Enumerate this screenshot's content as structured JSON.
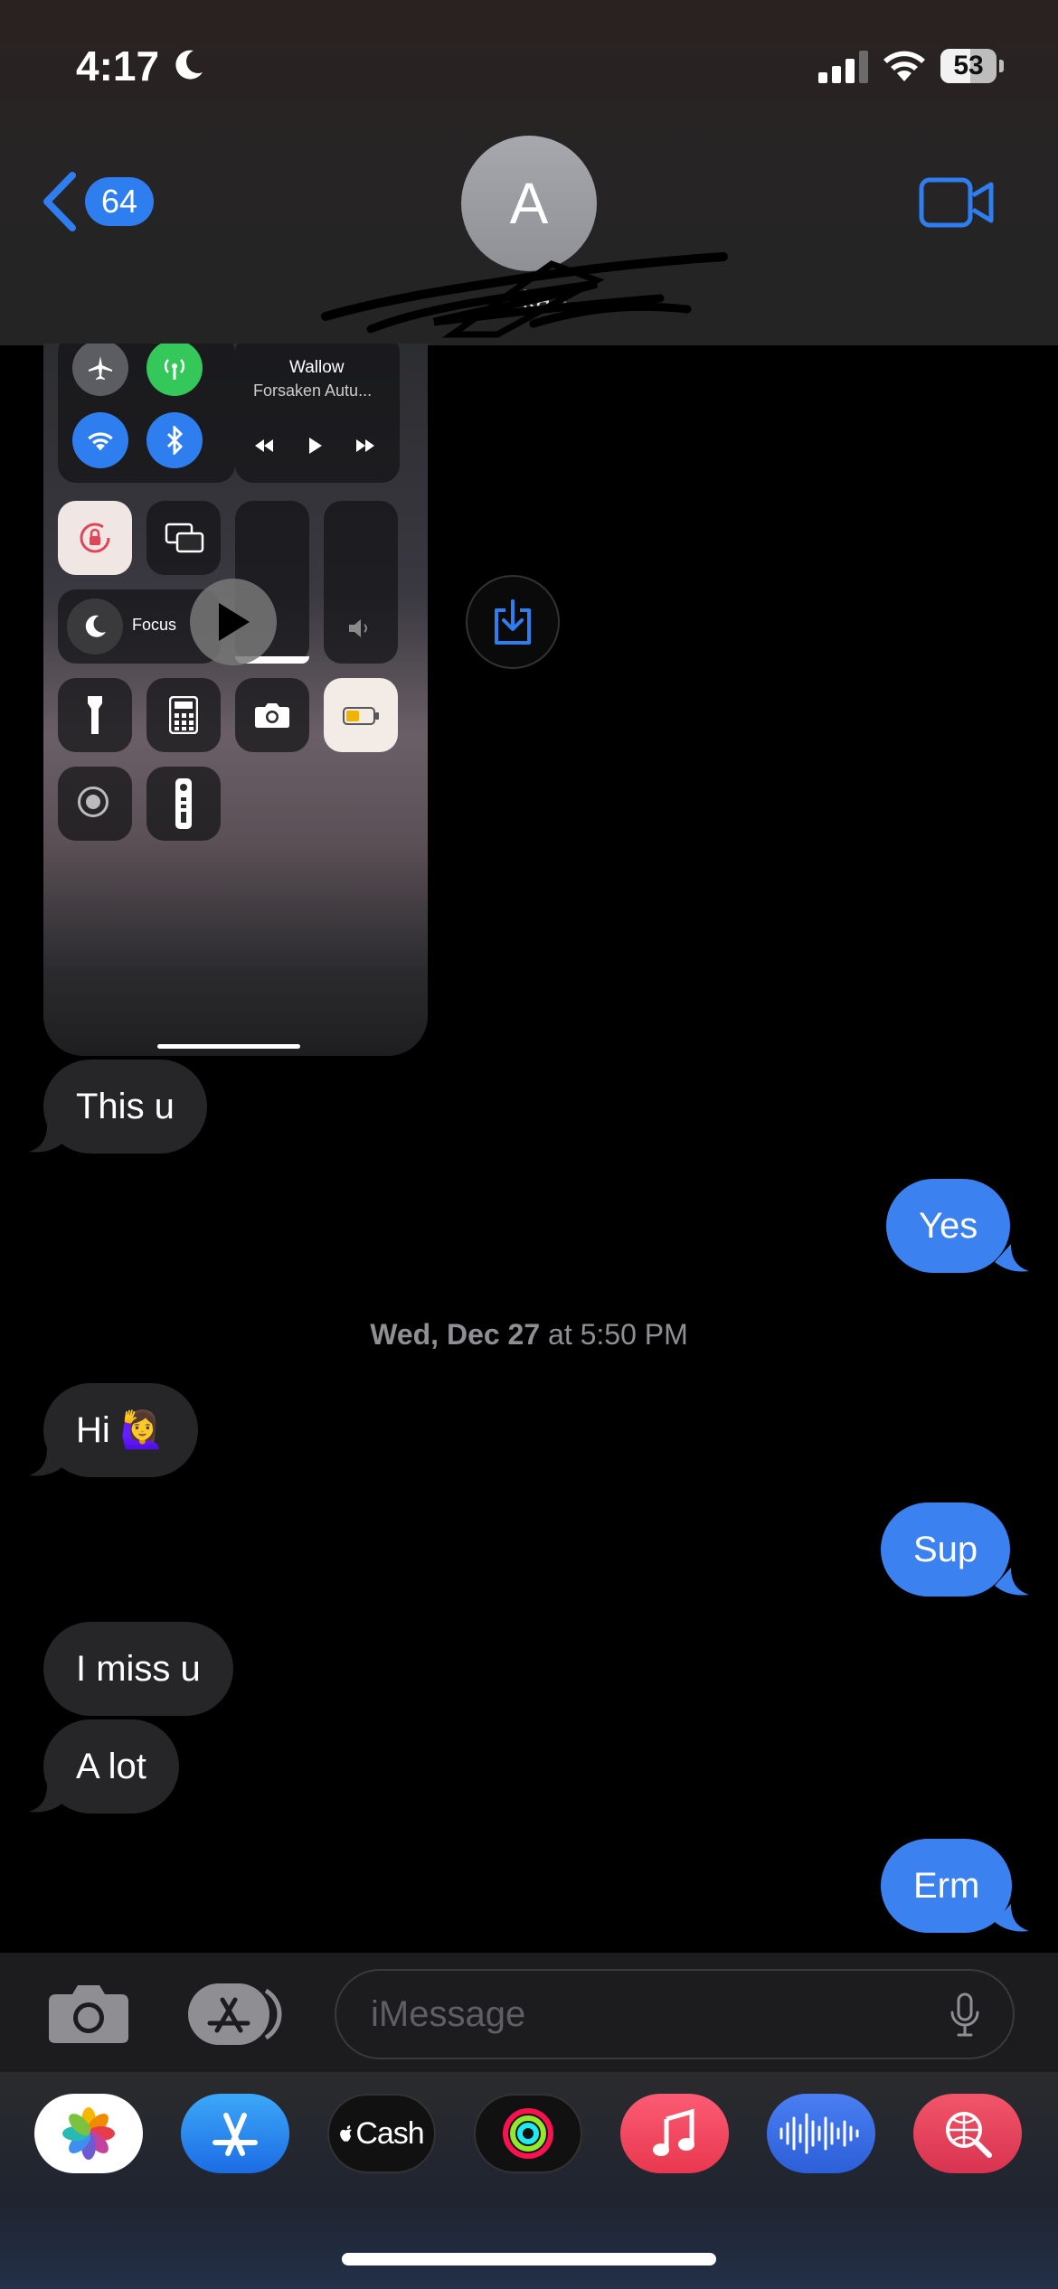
{
  "status_bar": {
    "time": "4:17",
    "battery": "53",
    "battery_level": 0.53
  },
  "header": {
    "back_count": "64",
    "avatar_initial": "A",
    "contact_name": "ar ka"
  },
  "attachment": {
    "now_playing_title": "Wallow",
    "now_playing_artist": "Forsaken Autu...",
    "focus_label": "Focus"
  },
  "messages": [
    {
      "dir": "in",
      "text": "This u"
    },
    {
      "dir": "out",
      "text": "Yes"
    },
    {
      "dir": "in",
      "text": "Hi 🙋‍♀️"
    },
    {
      "dir": "out",
      "text": "Sup"
    },
    {
      "dir": "in",
      "text": "I miss u"
    },
    {
      "dir": "in",
      "text": "A lot"
    },
    {
      "dir": "out",
      "text": "Erm"
    }
  ],
  "timestamp": {
    "day": "Wed, Dec 27",
    "time": "at 5:50 PM"
  },
  "composer": {
    "placeholder": "iMessage"
  },
  "app_drawer": {
    "cash_label": "Cash"
  },
  "colors": {
    "accent": "#3b82f0",
    "incoming_bubble": "#262628",
    "background": "#000000"
  }
}
